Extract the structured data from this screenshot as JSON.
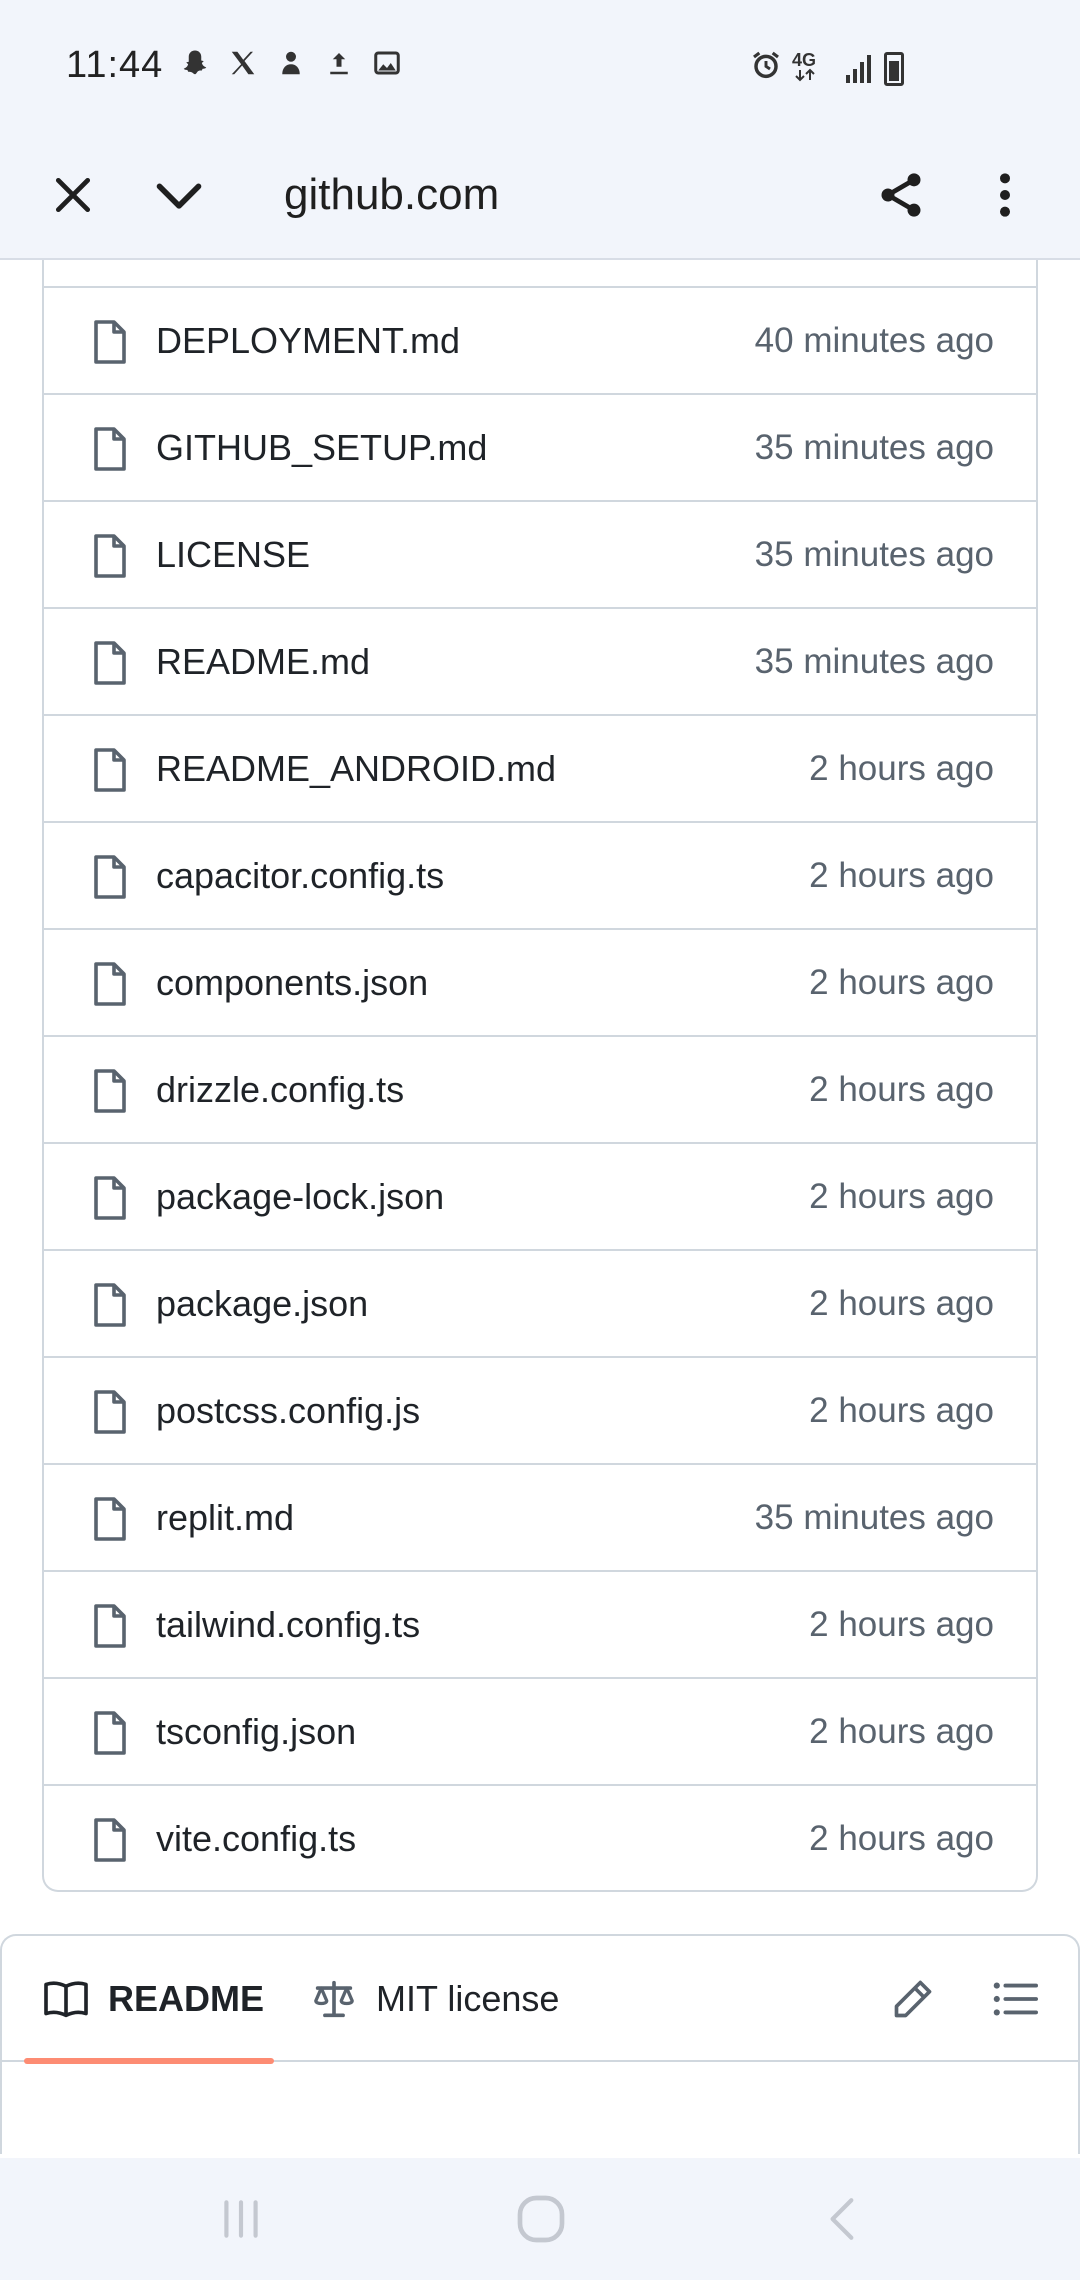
{
  "status_bar": {
    "time": "11:44",
    "left_icons": [
      "snapchat-icon",
      "x-icon",
      "app-icon",
      "upload-icon",
      "image-icon"
    ],
    "right_icons": [
      "alarm-icon",
      "4g-icon",
      "signal-icon",
      "battery-icon"
    ],
    "network": "4G"
  },
  "toolbar": {
    "url": "github.com",
    "close_icon": "close-icon",
    "collapse_icon": "chevron-down-icon",
    "share_icon": "share-icon",
    "menu_icon": "more-vert-icon"
  },
  "files": [
    {
      "name": "DEPLOYMENT.md",
      "time": "40 minutes ago"
    },
    {
      "name": "GITHUB_SETUP.md",
      "time": "35 minutes ago"
    },
    {
      "name": "LICENSE",
      "time": "35 minutes ago"
    },
    {
      "name": "README.md",
      "time": "35 minutes ago"
    },
    {
      "name": "README_ANDROID.md",
      "time": "2 hours ago"
    },
    {
      "name": "capacitor.config.ts",
      "time": "2 hours ago"
    },
    {
      "name": "components.json",
      "time": "2 hours ago"
    },
    {
      "name": "drizzle.config.ts",
      "time": "2 hours ago"
    },
    {
      "name": "package-lock.json",
      "time": "2 hours ago"
    },
    {
      "name": "package.json",
      "time": "2 hours ago"
    },
    {
      "name": "postcss.config.js",
      "time": "2 hours ago"
    },
    {
      "name": "replit.md",
      "time": "35 minutes ago"
    },
    {
      "name": "tailwind.config.ts",
      "time": "2 hours ago"
    },
    {
      "name": "tsconfig.json",
      "time": "2 hours ago"
    },
    {
      "name": "vite.config.ts",
      "time": "2 hours ago"
    }
  ],
  "readme_tabs": {
    "readme_label": "README",
    "license_label": "MIT license",
    "active_underline_color": "#fd8c73"
  }
}
